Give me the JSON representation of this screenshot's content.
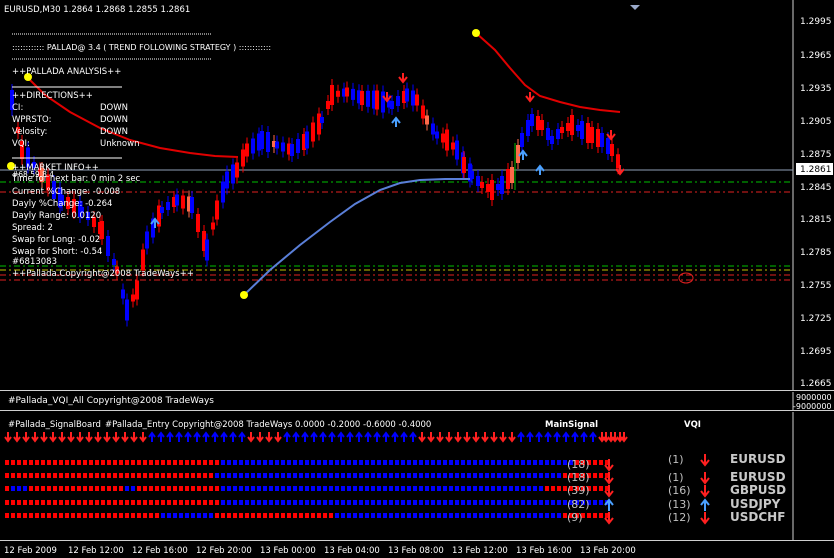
{
  "header": {
    "symbol_ohlc": "EURUSD,M30  1.2864 1.2868 1.2855 1.2861"
  },
  "info_panel": {
    "dots_line": ":::::::::::::::::::::::::::::::::::::::::::::::::::::::::::::::::::::::::::::::::::::::",
    "title": ":::::::::::: PALLAD@ 3.4 ( TREND FOLLOWING STRATEGY ) ::::::::::::",
    "analysis": "++PALLADA ANALYSIS++",
    "directions": "++DIRECTIONS++",
    "rows": [
      {
        "label": "CI:",
        "value": "DOWN"
      },
      {
        "label": "WPRSTO:",
        "value": "DOWN"
      },
      {
        "label": "Velosity:",
        "value": "DOWN"
      },
      {
        "label": "VQI:",
        "value": "Unknown"
      }
    ],
    "market_info": "++MARKET INFO++",
    "overlap": "#68.59.8.4",
    "lines": [
      "Time for next bar: 0 min 2 sec",
      "Current %Change: -0.008",
      "Dayly %Change: -0.264",
      "Dayly Range: 0.0120",
      "Spread: 2",
      "Swap for Long: -0.02",
      "Swap for Short: -0.54",
      "#6813083"
    ],
    "copyright": "++Pallada.Copyright@2008 TradeWays++"
  },
  "price_axis": {
    "labels": [
      "1.2995",
      "1.2965",
      "1.2935",
      "1.2905",
      "1.2875",
      "1.2845",
      "1.2815",
      "1.2785",
      "1.2755",
      "1.2725",
      "1.2695",
      "1.2665"
    ],
    "current_price": "1.2861"
  },
  "vqi_panel": {
    "title": "#Pallada_VQI_All Copyright@2008 TradeWays",
    "axis_top": "9000000",
    "axis_bottom": "-9000000"
  },
  "signal_panel": {
    "title_left": "#Pallada_SignalBoard",
    "title_entry": "#Pallada_Entry Copyright@2008 TradeWays 0.0000 -0.2000 -0.6000 -0.4000",
    "main_signal": "MainSignal",
    "vqi_header": "VQI",
    "pairs": [
      {
        "count": "(18)",
        "vqi": "(1)",
        "vqi_dir": "down",
        "symbol": "EURUSD"
      },
      {
        "count": "(18)",
        "vqi": "(1)",
        "vqi_dir": "down",
        "symbol": "EURUSD"
      },
      {
        "count": "(39)",
        "vqi": "(16)",
        "vqi_dir": "down",
        "symbol": "GBPUSD"
      },
      {
        "count": "(82)",
        "vqi": "(13)",
        "vqi_dir": "up",
        "symbol": "USDJPY"
      },
      {
        "count": "(9)",
        "vqi": "(12)",
        "vqi_dir": "down",
        "symbol": "USDCHF"
      }
    ]
  },
  "time_axis": {
    "labels": [
      "12 Feb 2009",
      "12 Feb 12:00",
      "12 Feb 16:00",
      "12 Feb 20:00",
      "13 Feb 00:00",
      "13 Feb 04:00",
      "13 Feb 08:00",
      "13 Feb 12:00",
      "13 Feb 16:00",
      "13 Feb 20:00"
    ]
  },
  "colors": {
    "bull": "#0000ff",
    "bear": "#ff0000",
    "doji": "#ff6a4a",
    "ma_red": "#e00000",
    "ma_blue": "#5a7fd8",
    "dot": "#ffff00",
    "up_arrow": "#4aa0ff",
    "down_arrow": "#ff2020"
  }
}
